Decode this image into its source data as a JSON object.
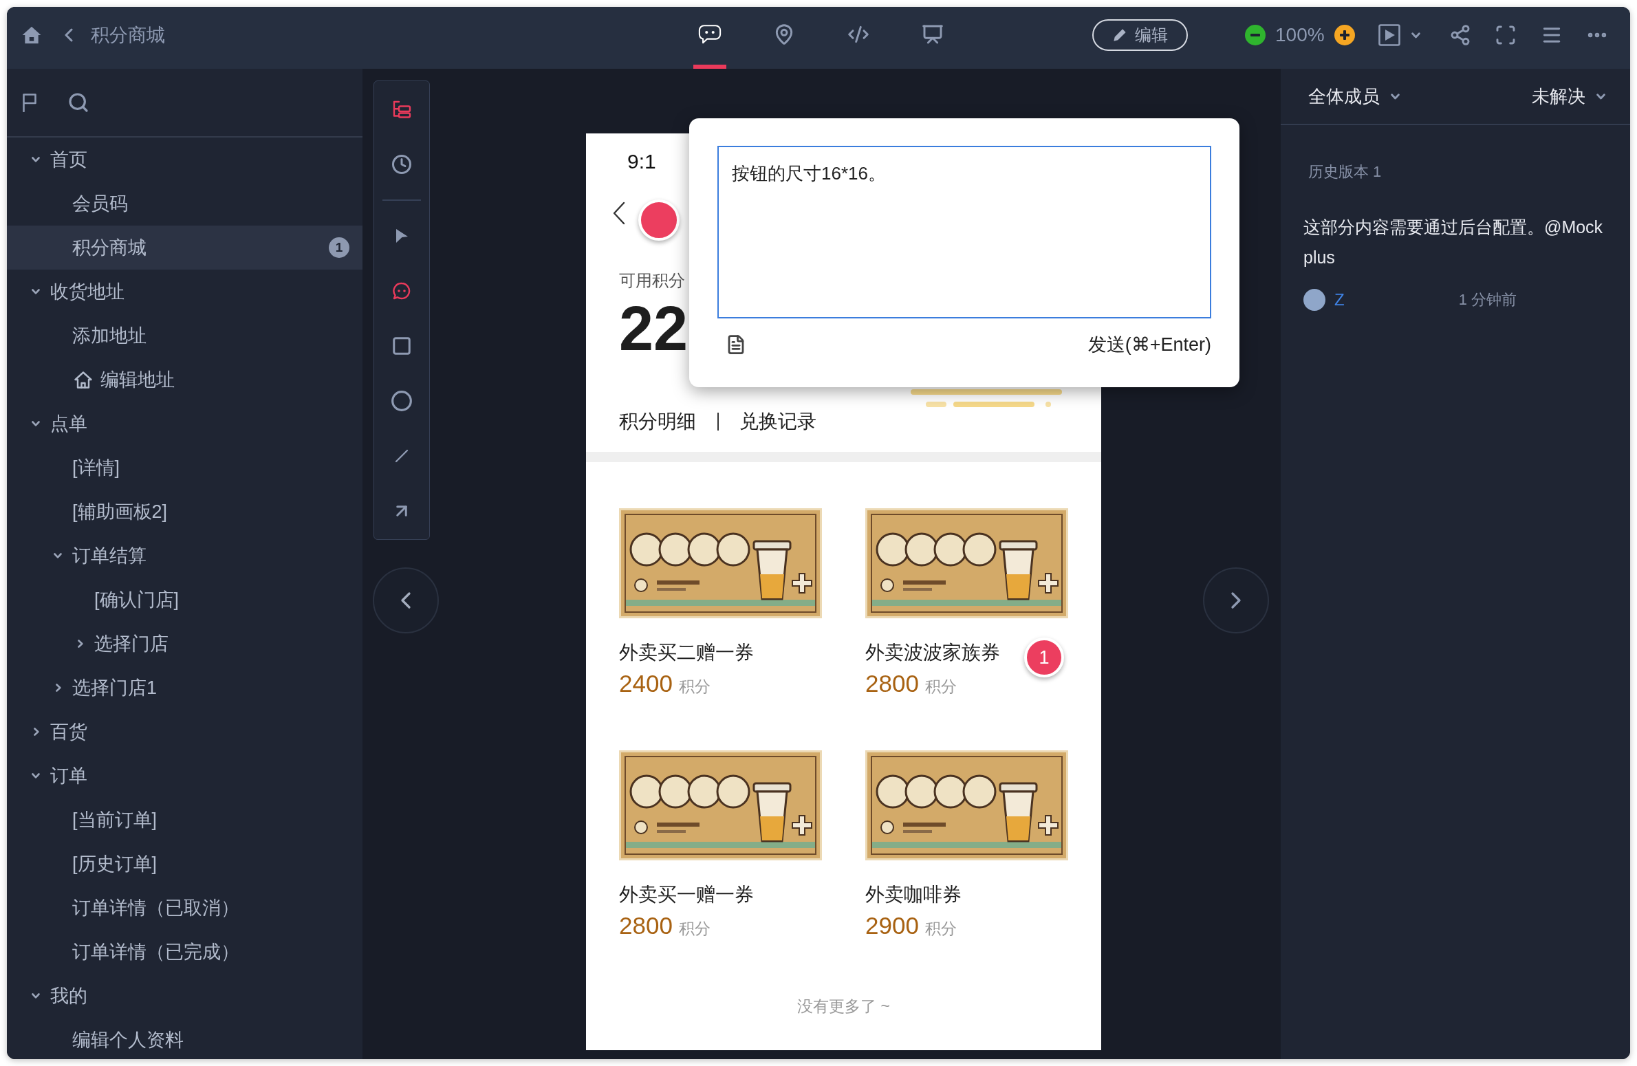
{
  "top_bar": {
    "title": "积分商城",
    "view_tabs": [
      {
        "selected": true
      },
      {
        "selected": false
      },
      {
        "selected": false
      },
      {
        "selected": false
      }
    ],
    "edit_button": "编辑",
    "zoom_level": "100%"
  },
  "sidebar": {
    "tree": [
      {
        "label": "首页",
        "home_page": false,
        "selected": false,
        "expanded": true,
        "children": [
          {
            "label": "会员码",
            "home_page": false,
            "selected": false
          },
          {
            "label": "积分商城",
            "home_page": false,
            "selected": true,
            "badge": "1"
          }
        ]
      },
      {
        "label": "收货地址",
        "home_page": false,
        "selected": false,
        "expanded": true,
        "children": [
          {
            "label": "添加地址",
            "home_page": false,
            "selected": false
          },
          {
            "label": "编辑地址",
            "home_page": true,
            "selected": false
          }
        ]
      },
      {
        "label": "点单",
        "home_page": false,
        "selected": false,
        "expanded": true,
        "children": [
          {
            "label": "[详情]",
            "home_page": false,
            "selected": false
          },
          {
            "label": "[辅助画板2]",
            "home_page": false,
            "selected": false
          },
          {
            "label": "订单结算",
            "home_page": false,
            "selected": false,
            "expanded": true,
            "children": [
              {
                "label": "[确认门店]",
                "home_page": false,
                "selected": false
              },
              {
                "label": "选择门店",
                "home_page": false,
                "selected": false,
                "expanded": false
              }
            ]
          },
          {
            "label": "选择门店1",
            "home_page": false,
            "selected": false,
            "expanded": false
          }
        ]
      },
      {
        "label": "百货",
        "home_page": false,
        "selected": false,
        "expanded": false
      },
      {
        "label": "订单",
        "home_page": false,
        "selected": false,
        "expanded": true,
        "children": [
          {
            "label": "[当前订单]",
            "home_page": false,
            "selected": false
          },
          {
            "label": "[历史订单]",
            "home_page": false,
            "selected": false
          },
          {
            "label": "订单详情（已取消）",
            "home_page": false,
            "selected": false
          },
          {
            "label": "订单详情（已完成）",
            "home_page": false,
            "selected": false
          }
        ]
      },
      {
        "label": "我的",
        "home_page": false,
        "selected": false,
        "expanded": true,
        "children": [
          {
            "label": "编辑个人资料",
            "home_page": false,
            "selected": false
          }
        ]
      }
    ]
  },
  "tool_strip": {
    "groups": [
      {
        "tools": [
          {
            "selected": true
          },
          {
            "selected": false
          }
        ]
      },
      {
        "tools": [
          {
            "selected": false
          },
          {
            "selected": true
          },
          {
            "selected": false
          },
          {
            "selected": false
          },
          {
            "selected": false
          },
          {
            "selected": false
          }
        ]
      }
    ]
  },
  "phone": {
    "status_time": "9:1",
    "points_label": "可用积分",
    "points": "22",
    "links": [
      "积分明细",
      "兑换记录"
    ],
    "coupons": [
      {
        "title": "外卖买二赠一券",
        "price": "2400",
        "unit": "积分"
      },
      {
        "title": "外卖波波家族券",
        "price": "2800",
        "unit": "积分"
      },
      {
        "title": "外卖买一赠一券",
        "price": "2800",
        "unit": "积分"
      },
      {
        "title": "外卖咖啡券",
        "price": "2900",
        "unit": "积分"
      }
    ],
    "comment_pin": "1",
    "end_note": "没有更多了 ~"
  },
  "comment_popup": {
    "text": "按钮的尺寸16*16。",
    "send_button": "发送(⌘+Enter)"
  },
  "comments_panel": {
    "filters": [
      "全体成员",
      "未解决"
    ],
    "version_label": "历史版本 1",
    "comments": [
      {
        "text": "这部分内容需要通过后台配置。@Mock plus",
        "author": "Z",
        "time": "1 分钟前"
      }
    ]
  }
}
